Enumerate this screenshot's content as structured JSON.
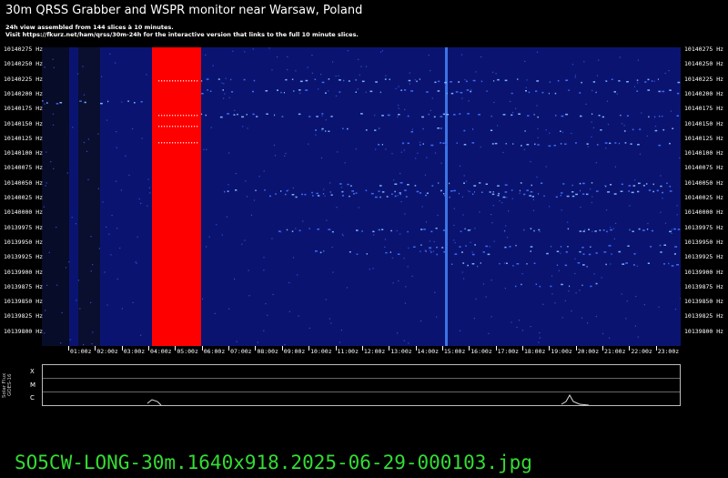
{
  "header": {
    "title": "30m QRSS Grabber and WSPR monitor near Warsaw, Poland",
    "line1": "24h view assembled from 144 slices à 10 minutes.",
    "line2": "Visit https://fkurz.net/ham/qrss/30m-24h for the interactive version that links to the full 10 minute slices."
  },
  "waterfall": {
    "frequencies": [
      "10140275 Hz",
      "10140250 Hz",
      "10140225 Hz",
      "10140200 Hz",
      "10140175 Hz",
      "10140150 Hz",
      "10140125 Hz",
      "10140100 Hz",
      "10140075 Hz",
      "10140050 Hz",
      "10140025 Hz",
      "10140000 Hz",
      "10139975 Hz",
      "10139950 Hz",
      "10139925 Hz",
      "10139900 Hz",
      "10139875 Hz",
      "10139850 Hz",
      "10139825 Hz",
      "10139800 Hz"
    ],
    "hours": [
      "01:00z",
      "02:00z",
      "03:00z",
      "04:00z",
      "05:00z",
      "06:00z",
      "07:00z",
      "08:00z",
      "09:00z",
      "10:00z",
      "11:00z",
      "12:00z",
      "13:00z",
      "14:00z",
      "15:00z",
      "16:00z",
      "17:00z",
      "18:00z",
      "19:00z",
      "20:00z",
      "21:00z",
      "22:00z",
      "23:00z"
    ],
    "background_color": "#0a1470",
    "gap_color": "#ff0000"
  },
  "solar": {
    "side_label": "Solar Flux GOES-16",
    "levels": [
      "X",
      "M",
      "C"
    ]
  },
  "filename": "SO5CW-LONG-30m.1640x918.2025-06-29-000103.jpg"
}
